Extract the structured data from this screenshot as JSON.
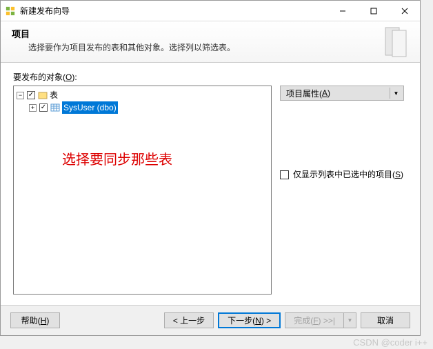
{
  "titlebar": {
    "title": "新建发布向导"
  },
  "header": {
    "title": "项目",
    "desc": "选择要作为项目发布的表和其他对象。选择列以筛选表。"
  },
  "objects_label_pre": "要发布的对象(",
  "objects_label_key": "O",
  "objects_label_post": "):",
  "tree": {
    "root": {
      "label": "表"
    },
    "child": {
      "label": "SysUser (dbo)"
    }
  },
  "annotation": "选择要同步那些表",
  "properties_btn_pre": "项目属性(",
  "properties_btn_key": "A",
  "properties_btn_post": ")",
  "show_checked_pre": "仅显示列表中已选中的项目(",
  "show_checked_key": "S",
  "show_checked_post": ")",
  "footer": {
    "help_pre": "帮助(",
    "help_key": "H",
    "help_post": ")",
    "back": "< 上一步",
    "next_pre": "下一步(",
    "next_key": "N",
    "next_post": ") >",
    "finish_pre": "完成(",
    "finish_key": "F",
    "finish_post": ") >>|",
    "cancel": "取消"
  },
  "watermark": "CSDN @coder i++"
}
